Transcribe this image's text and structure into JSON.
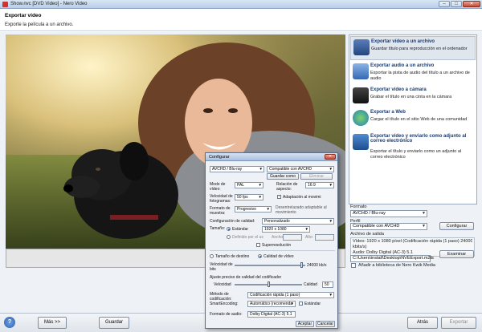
{
  "window": {
    "title": "Show.nvc [DVD Video] - Nero Video",
    "minimize": "–",
    "maximize": "□",
    "close": "✕"
  },
  "header": {
    "title": "Exportar vídeo",
    "subtitle": "Exporte la película a un archivo."
  },
  "export_options": [
    {
      "title": "Exportar vídeo a un archivo",
      "desc": "Guardar título para reproducción en el ordenador",
      "icon": "film-file-icon"
    },
    {
      "title": "Exportar audio a un archivo",
      "desc": "Exportar la pista de audio del título a un archivo de audio",
      "icon": "audio-file-icon"
    },
    {
      "title": "Exportar vídeo a cámara",
      "desc": "Grabar el título en una cinta en la cámara",
      "icon": "camera-icon"
    },
    {
      "title": "Exportar a Web",
      "desc": "Cargar el título en el sitio Web de una comunidad",
      "icon": "globe-icon"
    },
    {
      "title": "Exportar vídeo y enviarlo como adjunto al correo electrónico",
      "desc": "Exportar el título y enviarlo como un adjunto al correo electrónico",
      "icon": "email-icon"
    }
  ],
  "format": {
    "label": "Formato",
    "value": "AVCHD / Blu-ray",
    "profile_label": "Perfil",
    "profile_value": "Compatible con AVCHD",
    "configure_label": "Configurar"
  },
  "output": {
    "label": "Archivo de salida",
    "line1": "Vídeo: 1920 x 1080 píxel (Codificación rápida (1 paso) 24000",
    "line2": "kbits/s)",
    "line3": "Audio: Dolby Digital (AC-3) 5.1",
    "path": "C:\\Users\\install\\Desktop\\NVEExport.m2ts",
    "browse_label": "Examinar"
  },
  "library": {
    "label": "Añadir a biblioteca de Nero Kwik Media",
    "checked": false
  },
  "footer": {
    "help": "?",
    "more_label": "Más >>",
    "save_label": "Guardar",
    "back_label": "Atrás",
    "export_label": "Exportar"
  },
  "dialog": {
    "title": "Configurar",
    "close": "✕",
    "preset": "AVCHD / Blu-ray",
    "compat": "Compatible con AVCHD",
    "save_as": "Guardar como",
    "delete": "Eliminar",
    "video_mode_label": "Modo de vídeo:",
    "video_mode": "PAL",
    "aspect_label": "Relación de aspecto:",
    "aspect": "16:9",
    "frame_rate_label": "Velocidad de fotogramas:",
    "frame_rate": "50 fps",
    "adapt_motion": "Adaptación al movimi",
    "sample_format_label": "Formato de muestra:",
    "sample_format": "Progresivo",
    "deinterlace": "Desentrelazado adaptable al movimiento",
    "quality_label": "Configuración de calidad:",
    "quality": "Personalizado",
    "size_label": "Tamaño:",
    "standard": "Estándar",
    "standard_value": "1920 x 1080",
    "custom_user": "Definido por el us",
    "width_label": "Ancho:",
    "height_label": "Alto:",
    "superres": "Superresolución",
    "target_size": "Tamaño de destino",
    "video_quality": "Calidad de vídeo",
    "bitrate_label": "Velocidad de bits",
    "bitrate": "24000 kb/s",
    "encoder_fine": "Ajuste preciso de calidad del codificador",
    "speed_label": "Velocidad",
    "quality_slider_label": "Calidad",
    "quality_value": "50",
    "encode_method_label": "Método de codificación:",
    "encode_method": "Codificación rápida (1 paso)",
    "smart_label": "SmartEncoding:",
    "smart": "Automático (recomenda",
    "standard_chk": "Estándar",
    "audio_format_label": "Formato de audio:",
    "audio_format": "Dolby Digital (AC-3) 5.1",
    "accept": "Aceptar",
    "cancel": "Cancelar"
  }
}
